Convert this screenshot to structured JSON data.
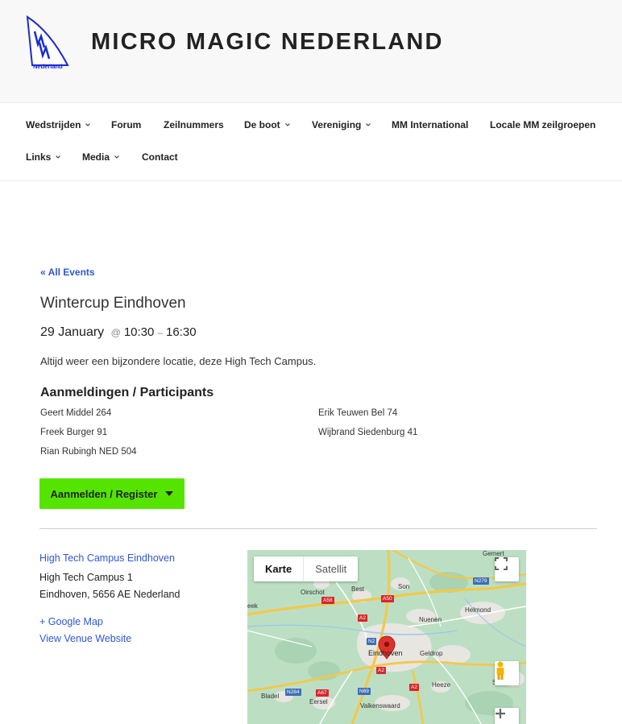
{
  "site": {
    "title": "MICRO MAGIC NEDERLAND",
    "logo_text": "Nederland",
    "accent_color": "#2f57d1"
  },
  "nav": {
    "items": [
      {
        "label": "Wedstrijden",
        "has_dropdown": true
      },
      {
        "label": "Forum",
        "has_dropdown": false
      },
      {
        "label": "Zeilnummers",
        "has_dropdown": false
      },
      {
        "label": "De boot",
        "has_dropdown": true
      },
      {
        "label": "Vereniging",
        "has_dropdown": true
      },
      {
        "label": "MM International",
        "has_dropdown": false
      },
      {
        "label": "Locale MM zeilgroepen",
        "has_dropdown": false
      },
      {
        "label": "Links",
        "has_dropdown": true
      },
      {
        "label": "Media",
        "has_dropdown": true
      },
      {
        "label": "Contact",
        "has_dropdown": false
      }
    ]
  },
  "event": {
    "back_link": "« All Events",
    "title": "Wintercup Eindhoven",
    "date": "29 January",
    "at": "@",
    "start_time": "10:30",
    "dash": "–",
    "end_time": "16:30",
    "description": "Altijd weer een bijzondere locatie, deze High Tech Campus.",
    "participants_title": "Aanmeldingen / Participants",
    "participants": [
      "Geert Middel 264",
      "Erik Teuwen Bel 74",
      "Freek Burger 91",
      "Wijbrand Siedenburg 41",
      "Rian Rubingh NED 504"
    ],
    "register_label": "Aanmelden / Register",
    "register_color": "#55e400"
  },
  "venue": {
    "name": "High Tech Campus Eindhoven",
    "street": "High Tech Campus 1",
    "city_line": "Eindhoven, 5656 AE Nederland",
    "google_map_link": "+ Google Map",
    "website_link": "View Venue Website"
  },
  "map": {
    "type_options": [
      "Karte",
      "Satellit"
    ],
    "active_type": "Karte",
    "places": [
      "Gemert",
      "Oirschot",
      "Best",
      "Son",
      "Helmond",
      "Nuenen",
      "Eindhoven",
      "Geldrop",
      "Heeze",
      "Bladel",
      "Eersel",
      "Valkenswaard",
      "eek",
      "Som"
    ],
    "roads": [
      "N279",
      "A58",
      "A50",
      "A2",
      "N2",
      "A2",
      "N284",
      "A67",
      "N69",
      "A2"
    ],
    "marker_color": "#e0322c"
  }
}
